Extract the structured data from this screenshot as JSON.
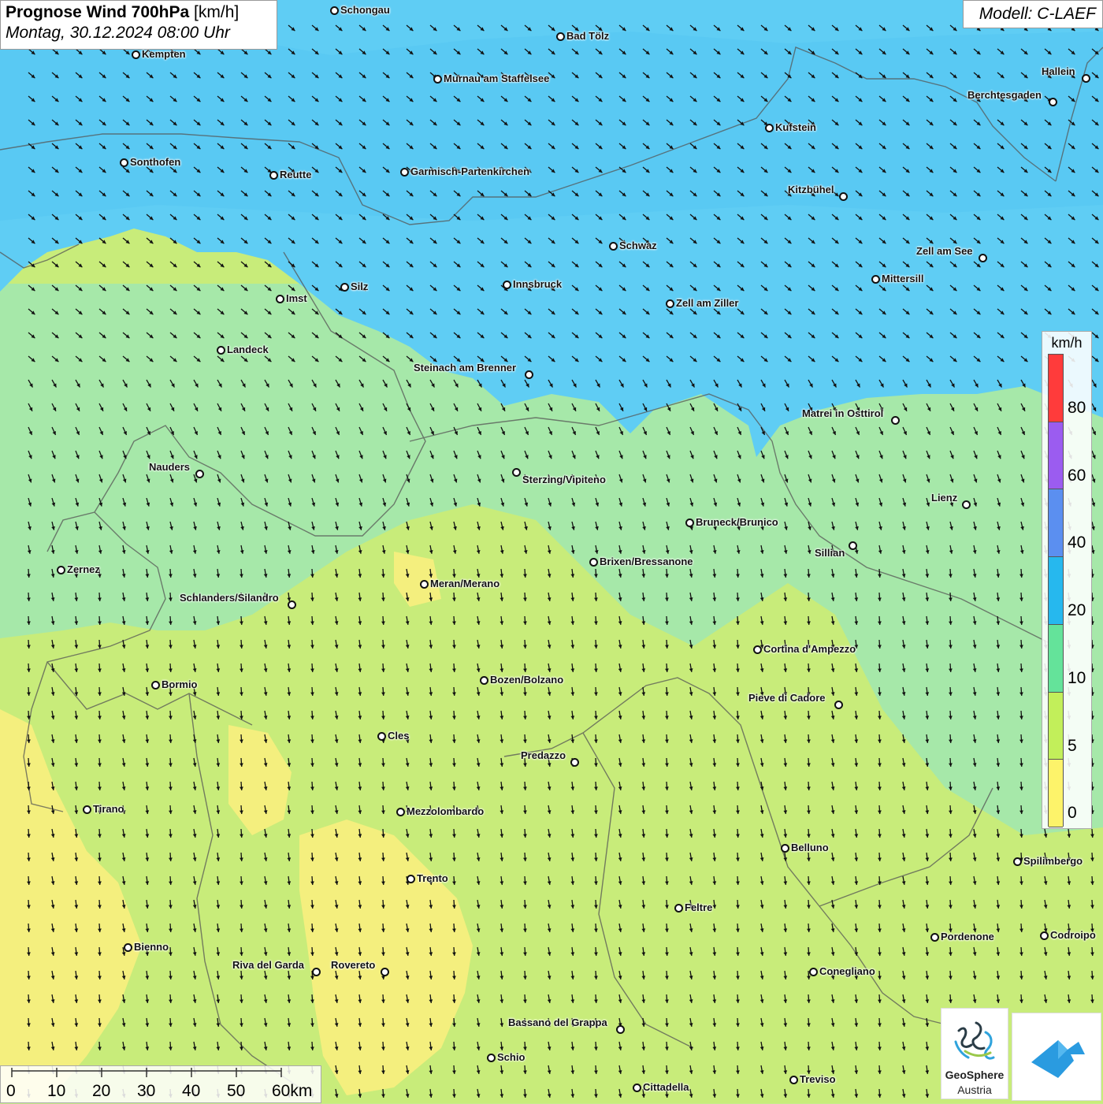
{
  "title": {
    "main": "Prognose Wind 700hPa",
    "unit": "[km/h]",
    "date": "Montag, 30.12.2024 08:00 Uhr"
  },
  "model": "Modell: C-LAEF",
  "legend": {
    "unit": "km/h",
    "labels": [
      "80",
      "60",
      "40",
      "20",
      "10",
      "5",
      "0"
    ],
    "colors": [
      "#ff3b3b",
      "#9b5cf0",
      "#5b8ff0",
      "#26b8ee",
      "#64e39a",
      "#c2ef5a",
      "#fdf36a"
    ]
  },
  "scale": {
    "labels": [
      "0",
      "10",
      "20",
      "30",
      "40",
      "50",
      "60km"
    ]
  },
  "wind_zones": {
    "strong": "#5fcdf4",
    "moderate": "#a6e8a9",
    "weak": "#c8ec7a",
    "calm": "#f4ef7e"
  },
  "cities": [
    {
      "name": "Schongau"
    },
    {
      "name": "Kempten"
    },
    {
      "name": "Bad Tölz"
    },
    {
      "name": "Murnau am Staffelsee"
    },
    {
      "name": "Hallein"
    },
    {
      "name": "Berchtesgaden"
    },
    {
      "name": "Kufstein"
    },
    {
      "name": "Sonthofen"
    },
    {
      "name": "Reutte"
    },
    {
      "name": "Garmisch-Partenkirchen"
    },
    {
      "name": "Kitzbühel"
    },
    {
      "name": "Schwaz"
    },
    {
      "name": "Zell am See"
    },
    {
      "name": "Mittersill"
    },
    {
      "name": "Innsbruck"
    },
    {
      "name": "Silz"
    },
    {
      "name": "Imst"
    },
    {
      "name": "Zell am Ziller"
    },
    {
      "name": "Landeck"
    },
    {
      "name": "Steinach am Brenner"
    },
    {
      "name": "Matrei in Osttirol"
    },
    {
      "name": "Nauders"
    },
    {
      "name": "Sterzing/Vipiteno"
    },
    {
      "name": "Lienz"
    },
    {
      "name": "Bruneck/Brunico"
    },
    {
      "name": "Sillian"
    },
    {
      "name": "Brixen/Bressanone"
    },
    {
      "name": "Zernez"
    },
    {
      "name": "Meran/Merano"
    },
    {
      "name": "Schlanders/Silandro"
    },
    {
      "name": "Cortina d'Ampezzo"
    },
    {
      "name": "Bormio"
    },
    {
      "name": "Bozen/Bolzano"
    },
    {
      "name": "Pieve di Cadore"
    },
    {
      "name": "Cles"
    },
    {
      "name": "Predazzo"
    },
    {
      "name": "Tirano"
    },
    {
      "name": "Mezzolombardo"
    },
    {
      "name": "Belluno"
    },
    {
      "name": "Spilimbergo"
    },
    {
      "name": "Trento"
    },
    {
      "name": "Feltre"
    },
    {
      "name": "Bienno"
    },
    {
      "name": "Pordenone"
    },
    {
      "name": "Codroipo"
    },
    {
      "name": "Riva del Garda"
    },
    {
      "name": "Rovereto"
    },
    {
      "name": "Conegliano"
    },
    {
      "name": "Bassano del Grappa"
    },
    {
      "name": "Schio"
    },
    {
      "name": "Treviso"
    },
    {
      "name": "Cittadella"
    }
  ],
  "logos": {
    "geosphere": {
      "name": "GeoSphere",
      "sub": "Austria"
    }
  }
}
